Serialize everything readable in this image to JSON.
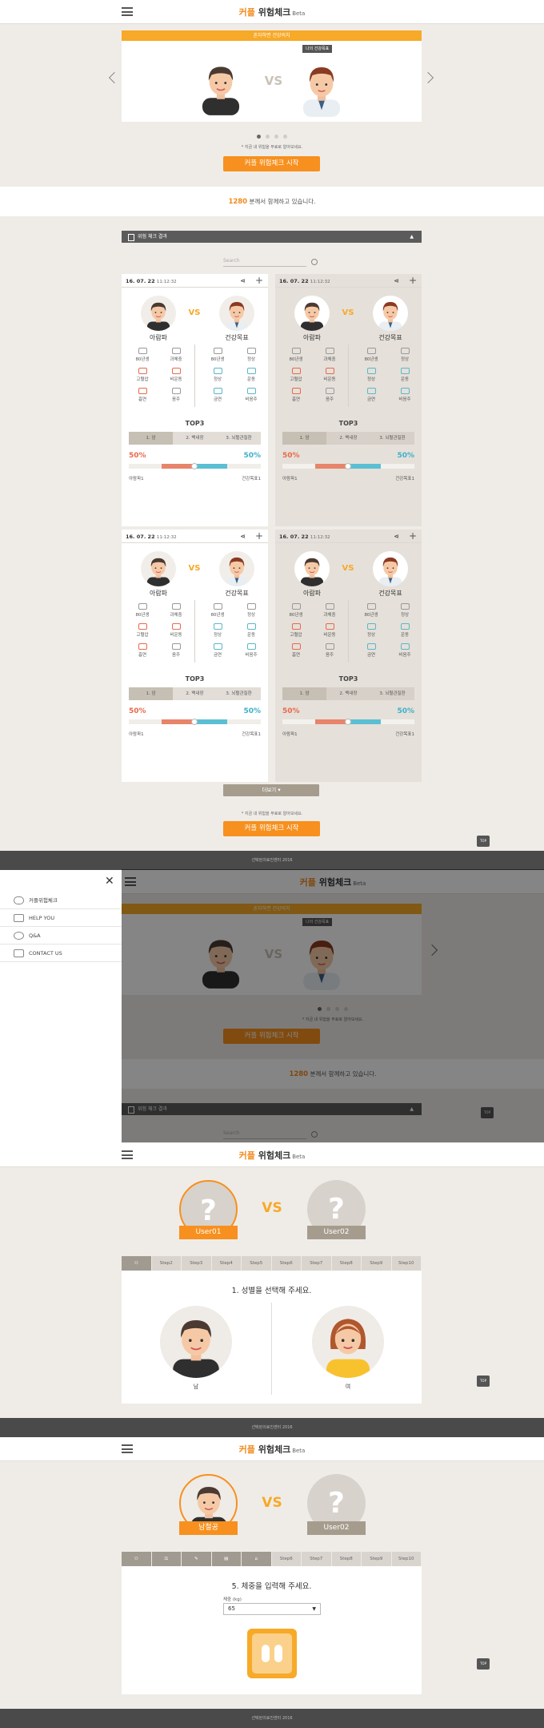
{
  "app": {
    "logo_brand": "커플",
    "logo_main": "위험체크",
    "logo_beta": "Beta"
  },
  "screen1": {
    "carousel_banner": "혼자하면 건강의치",
    "tag_label": "나의 건강목표",
    "vs": "VS",
    "note": "* 지금 내 위험을 무료로 알아보세요.",
    "start_button": "커플 위험체크 시작",
    "count_number": "1280",
    "count_text": "분께서 함께하고 있습니다.",
    "section_title": "위험 체크 결과",
    "search_placeholder": "Search",
    "more_button": "더보기",
    "note2": "* 지금 내 위험을 무료로 알아보세요.",
    "start_button2": "커플 위험체크 시작",
    "footer": "선택된의료진센터 2016",
    "top_label": "TOP"
  },
  "cards": [
    {
      "date": "16. 07. 22",
      "time": "11:12:32",
      "left_name": "아람파",
      "right_name": "건강목표",
      "vs": "VS",
      "top3": "TOP3",
      "tabs": [
        "1. 암",
        "2. 백내장",
        "3. 뇌혈관질환"
      ],
      "left_pct": "50%",
      "right_pct": "50%",
      "left_cap": "아람파1",
      "right_cap": "건강목표1",
      "left_pct_value": 50,
      "right_pct_value": 50
    },
    {
      "date": "16. 07. 22",
      "time": "11:12:32",
      "left_name": "아람파",
      "right_name": "건강목표",
      "vs": "VS",
      "top3": "TOP3",
      "tabs": [
        "1. 암",
        "2. 백내장",
        "3. 뇌혈관질환"
      ],
      "left_pct": "50%",
      "right_pct": "50%",
      "left_cap": "아람파1",
      "right_cap": "건강목표1",
      "left_pct_value": 50,
      "right_pct_value": 50
    },
    {
      "date": "16. 07. 22",
      "time": "11:12:32",
      "left_name": "아람파",
      "right_name": "건강목표",
      "vs": "VS",
      "top3": "TOP3",
      "tabs": [
        "1. 암",
        "2. 백내장",
        "3. 뇌혈관질환"
      ],
      "left_pct": "50%",
      "right_pct": "50%",
      "left_cap": "아람파1",
      "right_cap": "건강목표1",
      "left_pct_value": 50,
      "right_pct_value": 50
    },
    {
      "date": "16. 07. 22",
      "time": "11:12:32",
      "left_name": "아람파",
      "right_name": "건강목표",
      "vs": "VS",
      "top3": "TOP3",
      "tabs": [
        "1. 암",
        "2. 백내장",
        "3. 뇌혈관질환"
      ],
      "left_pct": "50%",
      "right_pct": "50%",
      "left_cap": "아람파1",
      "right_cap": "건강목표1",
      "left_pct_value": 50,
      "right_pct_value": 50
    }
  ],
  "stats_left": [
    "80년생",
    "과체중",
    "고혈압",
    "비운동",
    "흡연",
    "음주"
  ],
  "stats_right": [
    "80년생",
    "정상",
    "정상",
    "운동",
    "금연",
    "비음주"
  ],
  "menu": {
    "items": [
      "커플위험체크",
      "HELP YOU",
      "Q&A",
      "CONTACT US"
    ]
  },
  "screen3": {
    "user1": "User01",
    "user2": "User02",
    "question_mark": "?",
    "vs": "VS",
    "steps": [
      "",
      "Step2",
      "Step3",
      "Step4",
      "Step5",
      "Step6",
      "Step7",
      "Step8",
      "Step9",
      "Step10"
    ],
    "question": "1. 성별을 선택해 주세요.",
    "male": "남",
    "female": "여",
    "footer": "선택된의료진센터 2016",
    "top_label": "TOP"
  },
  "screen4": {
    "user1": "남철공",
    "user2": "User02",
    "question_mark": "?",
    "vs": "VS",
    "steps": [
      "",
      "",
      "",
      "",
      "",
      "Step6",
      "Step7",
      "Step8",
      "Step9",
      "Step10"
    ],
    "question": "5. 체중을 입력해 주세요.",
    "field_label": "체중 (kg)",
    "field_value": "65",
    "footer": "선택된의료진센터 2016",
    "top_label": "TOP"
  }
}
